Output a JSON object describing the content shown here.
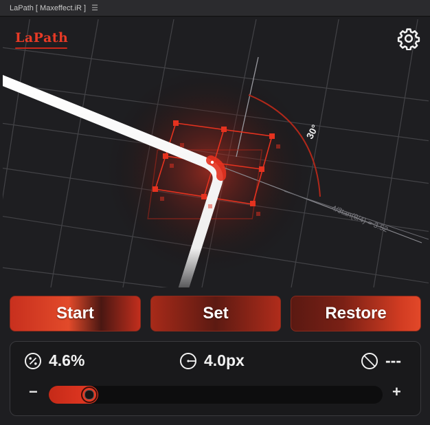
{
  "window": {
    "title": "LaPath [ Maxeffect.iR ]",
    "menu_icon": "hamburger-icon"
  },
  "header": {
    "logo_text": "LaPath",
    "settings_icon": "gear-icon"
  },
  "scene": {
    "angle_label": "30°",
    "formula_label": "4/3tan(θ/4) = 3.52",
    "accent_color": "#e5321f"
  },
  "actions": {
    "start": "Start",
    "set": "Set",
    "restore": "Restore"
  },
  "stats": {
    "percent": {
      "icon": "percent-icon",
      "value": "4.6%"
    },
    "radius": {
      "icon": "radius-icon",
      "value": "4.0px"
    },
    "diameter": {
      "icon": "diameter-icon",
      "value": "---"
    }
  },
  "slider": {
    "minus": "−",
    "plus": "+",
    "level": 0.05
  }
}
